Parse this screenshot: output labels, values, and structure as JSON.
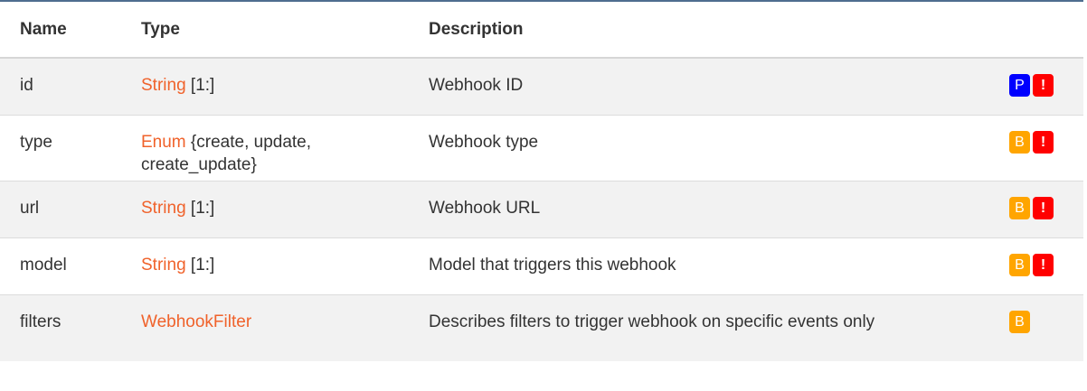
{
  "table": {
    "headers": {
      "name": "Name",
      "type": "Type",
      "description": "Description"
    },
    "rows": [
      {
        "name": "id",
        "type_link": "String",
        "type_rest": " [1:]",
        "description": "Webhook ID",
        "badges": [
          {
            "text": "P",
            "color": "#0000ff",
            "icon": "primary-key-badge"
          },
          {
            "text": "!",
            "color": "#ff0000",
            "icon": "required-badge"
          }
        ]
      },
      {
        "name": "type",
        "type_link": "Enum",
        "type_rest": " {create, update, create_update}",
        "description": "Webhook type",
        "badges": [
          {
            "text": "B",
            "color": "#ffa500",
            "icon": "basic-badge"
          },
          {
            "text": "!",
            "color": "#ff0000",
            "icon": "required-badge"
          }
        ]
      },
      {
        "name": "url",
        "type_link": "String",
        "type_rest": " [1:]",
        "description": "Webhook URL",
        "badges": [
          {
            "text": "B",
            "color": "#ffa500",
            "icon": "basic-badge"
          },
          {
            "text": "!",
            "color": "#ff0000",
            "icon": "required-badge"
          }
        ]
      },
      {
        "name": "model",
        "type_link": "String",
        "type_rest": " [1:]",
        "description": "Model that triggers this webhook",
        "badges": [
          {
            "text": "B",
            "color": "#ffa500",
            "icon": "basic-badge"
          },
          {
            "text": "!",
            "color": "#ff0000",
            "icon": "required-badge"
          }
        ]
      },
      {
        "name": "filters",
        "type_link": "WebhookFilter",
        "type_rest": "",
        "description": "Describes filters to trigger webhook on specific events only",
        "badges": [
          {
            "text": "B",
            "color": "#ffa500",
            "icon": "basic-badge"
          }
        ]
      }
    ]
  },
  "colors": {
    "link": "#f0622b",
    "row_stripe": "#f2f2f2",
    "top_rule": "#4f6d8f"
  }
}
